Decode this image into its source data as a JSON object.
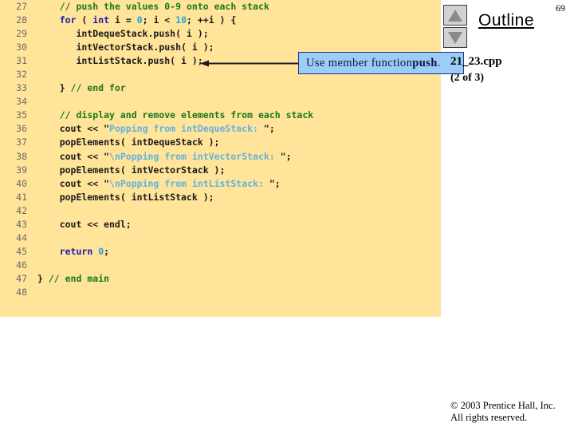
{
  "slide": {
    "number": "69",
    "outline_title": "Outline"
  },
  "nav": {
    "up_label": "▲",
    "down_label": "▼"
  },
  "file": {
    "name": "21_23.cpp",
    "part": "(2 of 3)"
  },
  "callout": {
    "text_before": "Use member function ",
    "term": "push",
    "text_after": "."
  },
  "footer": {
    "line1": "© 2003 Prentice Hall, Inc.",
    "line2": "All rights reserved."
  },
  "code": {
    "lines": [
      {
        "no": "27",
        "segments": [
          {
            "t": "    ",
            "c": "pln"
          },
          {
            "t": "// push the values 0-9 onto each stack",
            "c": "cmt"
          }
        ]
      },
      {
        "no": "28",
        "segments": [
          {
            "t": "    ",
            "c": "pln"
          },
          {
            "t": "for",
            "c": "kw"
          },
          {
            "t": " ( ",
            "c": "pln"
          },
          {
            "t": "int",
            "c": "kw"
          },
          {
            "t": " i = ",
            "c": "pln"
          },
          {
            "t": "0",
            "c": "num"
          },
          {
            "t": "; i < ",
            "c": "pln"
          },
          {
            "t": "10",
            "c": "num"
          },
          {
            "t": "; ++i ) {",
            "c": "pln"
          }
        ]
      },
      {
        "no": "29",
        "segments": [
          {
            "t": "       intDequeStack.push( i );",
            "c": "pln"
          }
        ]
      },
      {
        "no": "30",
        "segments": [
          {
            "t": "       intVectorStack.push( i );",
            "c": "pln"
          }
        ]
      },
      {
        "no": "31",
        "segments": [
          {
            "t": "       intListStack.push( i );",
            "c": "pln"
          }
        ]
      },
      {
        "no": "32",
        "segments": [
          {
            "t": "",
            "c": "pln"
          }
        ]
      },
      {
        "no": "33",
        "segments": [
          {
            "t": "    } ",
            "c": "pln"
          },
          {
            "t": "// end for",
            "c": "cmt"
          }
        ]
      },
      {
        "no": "34",
        "segments": [
          {
            "t": "",
            "c": "pln"
          }
        ]
      },
      {
        "no": "35",
        "segments": [
          {
            "t": "    ",
            "c": "pln"
          },
          {
            "t": "// display and remove elements from each stack",
            "c": "cmt"
          }
        ]
      },
      {
        "no": "36",
        "segments": [
          {
            "t": "    cout << ",
            "c": "pln"
          },
          {
            "t": "\"",
            "c": "pln"
          },
          {
            "t": "Popping from intDequeStack: ",
            "c": "str"
          },
          {
            "t": "\"",
            "c": "pln"
          },
          {
            "t": ";",
            "c": "pln"
          }
        ]
      },
      {
        "no": "37",
        "segments": [
          {
            "t": "    popElements( intDequeStack );",
            "c": "pln"
          }
        ]
      },
      {
        "no": "38",
        "segments": [
          {
            "t": "    cout << ",
            "c": "pln"
          },
          {
            "t": "\"",
            "c": "pln"
          },
          {
            "t": "\\nPopping from intVectorStack: ",
            "c": "str"
          },
          {
            "t": "\"",
            "c": "pln"
          },
          {
            "t": ";",
            "c": "pln"
          }
        ]
      },
      {
        "no": "39",
        "segments": [
          {
            "t": "    popElements( intVectorStack );",
            "c": "pln"
          }
        ]
      },
      {
        "no": "40",
        "segments": [
          {
            "t": "    cout << ",
            "c": "pln"
          },
          {
            "t": "\"",
            "c": "pln"
          },
          {
            "t": "\\nPopping from intListStack: ",
            "c": "str"
          },
          {
            "t": "\"",
            "c": "pln"
          },
          {
            "t": ";",
            "c": "pln"
          }
        ]
      },
      {
        "no": "41",
        "segments": [
          {
            "t": "    popElements( intListStack );",
            "c": "pln"
          }
        ]
      },
      {
        "no": "42",
        "segments": [
          {
            "t": "",
            "c": "pln"
          }
        ]
      },
      {
        "no": "43",
        "segments": [
          {
            "t": "    cout << endl;",
            "c": "pln"
          }
        ]
      },
      {
        "no": "44",
        "segments": [
          {
            "t": "",
            "c": "pln"
          }
        ]
      },
      {
        "no": "45",
        "segments": [
          {
            "t": "    ",
            "c": "pln"
          },
          {
            "t": "return",
            "c": "kw"
          },
          {
            "t": " ",
            "c": "pln"
          },
          {
            "t": "0",
            "c": "num"
          },
          {
            "t": ";",
            "c": "pln"
          }
        ]
      },
      {
        "no": "46",
        "segments": [
          {
            "t": "",
            "c": "pln"
          }
        ]
      },
      {
        "no": "47",
        "segments": [
          {
            "t": "} ",
            "c": "pln"
          },
          {
            "t": "// end main",
            "c": "cmt"
          }
        ]
      },
      {
        "no": "48",
        "segments": [
          {
            "t": "",
            "c": "pln"
          }
        ]
      }
    ]
  },
  "colors": {
    "code_background": "#ffe49a",
    "comment": "#1a7a1a",
    "keyword": "#1b1bb0",
    "number": "#22a3d8",
    "string": "#5fb3dd",
    "callout_fill": "#9bcdf5",
    "callout_border": "#1b2f8a",
    "line_number": "#6b6b63"
  }
}
